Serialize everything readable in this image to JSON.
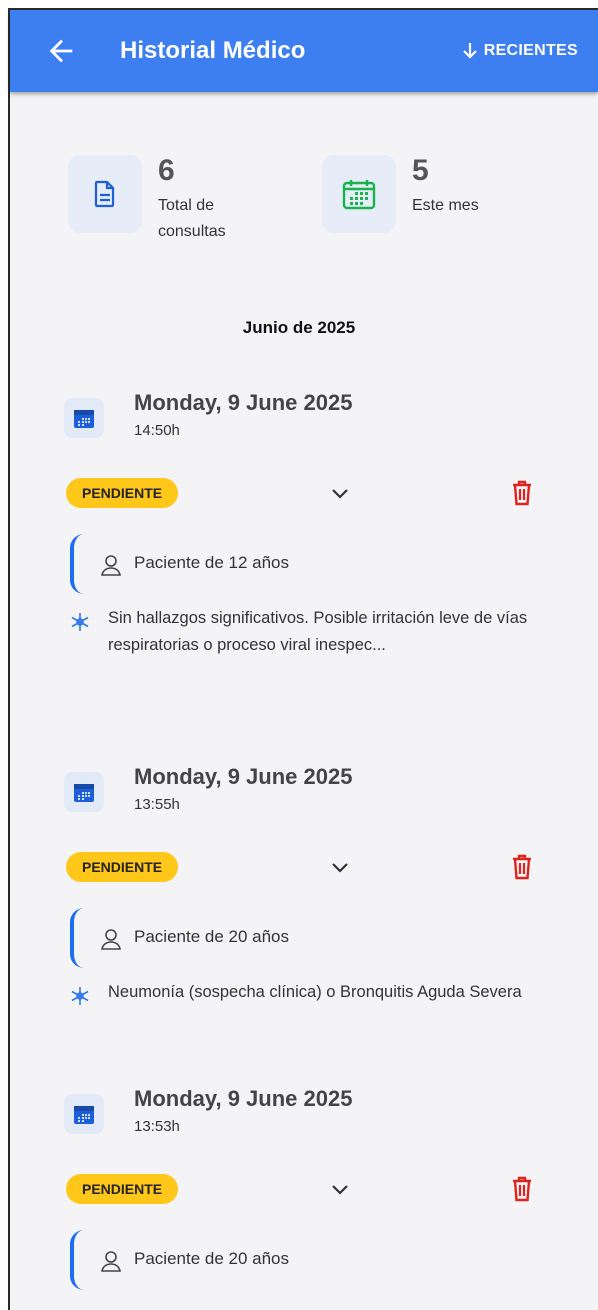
{
  "app_bar": {
    "title": "Historial Médico",
    "sort_label": "RECIENTES",
    "color": "#3d7ef0"
  },
  "stats": [
    {
      "value": "6",
      "label": "Total de consultas",
      "icon": "document-icon"
    },
    {
      "value": "5",
      "label": "Este mes",
      "icon": "calendar-grid-icon"
    }
  ],
  "month_header": "Junio de 2025",
  "consultations": [
    {
      "date": "Monday, 9 June 2025",
      "time": "14:50h",
      "status": "PENDIENTE",
      "patient": "Paciente de 12 años",
      "diagnosis": "Sin hallazgos significativos. Posible irritación leve de vías respiratorias o proceso viral inespec..."
    },
    {
      "date": "Monday, 9 June 2025",
      "time": "13:55h",
      "status": "PENDIENTE",
      "patient": "Paciente de 20 años",
      "diagnosis": "Neumonía (sospecha clínica) o Bronquitis Aguda Severa"
    },
    {
      "date": "Monday, 9 June 2025",
      "time": "13:53h",
      "status": "PENDIENTE",
      "patient": "Paciente de 20 años",
      "diagnosis": ""
    }
  ],
  "colors": {
    "status_badge": "#ffc71a",
    "delete": "#e0221c",
    "accent_blue": "#1e6ff0",
    "stat_green": "#18b34a"
  }
}
